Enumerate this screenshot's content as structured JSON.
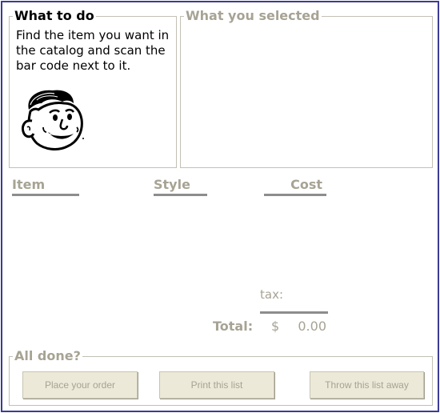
{
  "what_to_do": {
    "title": "What to do",
    "instructions": "Find the item you want in the catalog and scan the bar code next to it."
  },
  "selected": {
    "title": "What you selected"
  },
  "columns": {
    "item": "Item",
    "style": "Style",
    "cost": "Cost"
  },
  "totals": {
    "tax_label": "tax:",
    "total_label": "Total:",
    "currency": "$",
    "total_value": "0.00"
  },
  "all_done": {
    "title": "All done?",
    "buttons": {
      "place_order": "Place your order",
      "print_list": "Print this list",
      "throw_away": "Throw this list away"
    }
  },
  "icons": {
    "mascot": "smiling-man-face-icon"
  },
  "colors": {
    "frame_border": "#3c3c96",
    "muted_text": "#a7a394",
    "button_bg": "#ece9d8"
  }
}
